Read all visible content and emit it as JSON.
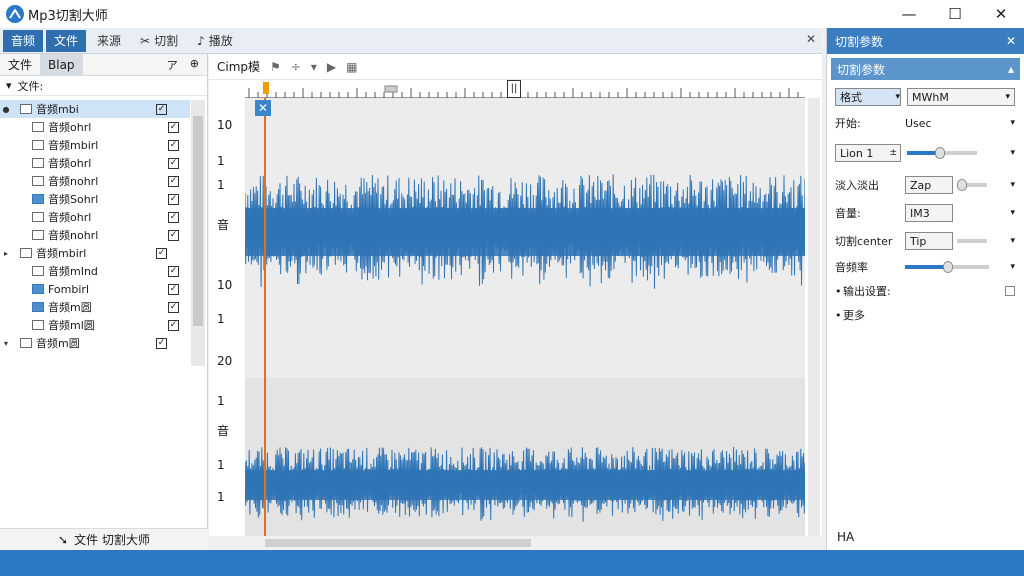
{
  "app": {
    "title": "Mp3切割大师"
  },
  "window_buttons": {
    "minimize": "—",
    "maximize": "☐",
    "close": "✕"
  },
  "toolbar": {
    "items": [
      {
        "label": "音频",
        "active": true
      },
      {
        "label": "文件",
        "active": true
      },
      {
        "label": "来源",
        "active": false
      },
      {
        "label": "切割",
        "active": false
      },
      {
        "label": "播放",
        "active": false
      }
    ],
    "close": "✕"
  },
  "left_panel": {
    "tabs": [
      "文件",
      "Blap"
    ],
    "tab_icons": [
      "ア",
      "⊕"
    ],
    "header": "文件:",
    "files": [
      {
        "label": "音频mbi",
        "selected": true,
        "arrow": "●"
      },
      {
        "label": "音频ohrl"
      },
      {
        "label": "音频mbirl"
      },
      {
        "label": "音频ohrl"
      },
      {
        "label": "音频nohrl"
      },
      {
        "label": "音频Sohrl",
        "blue": true
      },
      {
        "label": "音频ohrl"
      },
      {
        "label": "音频nohrl"
      },
      {
        "label": "音频mbirl",
        "arrow": "▸"
      },
      {
        "label": "音频mInd"
      },
      {
        "label": "Fombirl",
        "blue": true
      },
      {
        "label": "音频m圆",
        "blue": true
      },
      {
        "label": "音频ml圆"
      },
      {
        "label": "音频m圆",
        "arrow": "▾"
      }
    ],
    "footer": "文件  切割大师"
  },
  "center": {
    "toolbar_label": "Cimp模",
    "y_ticks": [
      "10",
      "1",
      "1",
      "音",
      "10",
      "1",
      "20",
      "1",
      "音",
      "1",
      "1"
    ],
    "ruler_marker": "||"
  },
  "right_panel": {
    "title": "切割参数",
    "close": "✕",
    "section": "切割参数",
    "rows": [
      {
        "label": "格式",
        "value": "MWhM"
      },
      {
        "label": "开始:",
        "value": "Usec"
      },
      {
        "label": "Lion 1",
        "value": ""
      },
      {
        "label": "淡入淡出",
        "value": "Zap"
      },
      {
        "label": "音量:",
        "value": "IM3"
      },
      {
        "label": "切割center",
        "value": "Tip"
      },
      {
        "label": "音频率",
        "value": ""
      },
      {
        "label": "输出设置:",
        "value": ""
      },
      {
        "label": "更多",
        "value": ""
      }
    ],
    "footer": "HA"
  },
  "colors": {
    "accent": "#2b78c4",
    "wave": "#2f74b5",
    "playhead": "#e07020"
  }
}
